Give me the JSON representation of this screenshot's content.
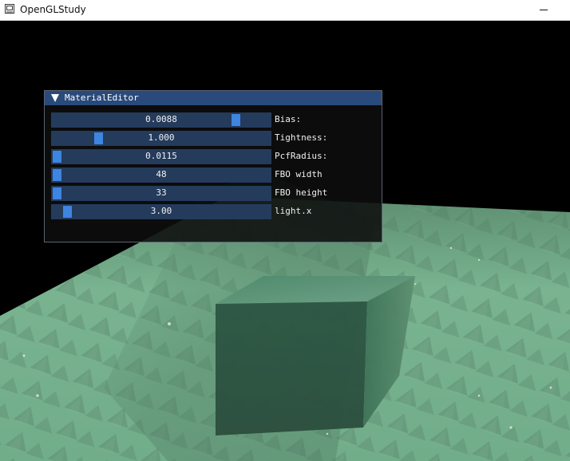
{
  "app": {
    "title": "OpenGLStudy",
    "icon": "app-window-icon",
    "controls": {
      "minimize_icon": "minimize-icon"
    }
  },
  "scene": {
    "background": "#000000",
    "terrain_color": "#79b38f",
    "cube_color": "#2f5a47"
  },
  "imgui": {
    "window_title": "MaterialEditor",
    "collapse_icon": "collapse-triangle-icon",
    "colors": {
      "title_bg": "#294a7a",
      "frame_bg": "#243b5c",
      "grab": "#3d85e0",
      "text": "#f0f0f0"
    },
    "sliders": [
      {
        "label": "Bias:",
        "value": "0.0088",
        "fraction": 0.86
      },
      {
        "label": "Tightness:",
        "value": "1.000",
        "fraction": 0.2
      },
      {
        "label": "PcfRadius:",
        "value": "0.0115",
        "fraction": 0.0
      },
      {
        "label": "FBO width",
        "value": "48",
        "fraction": 0.0
      },
      {
        "label": "FBO height",
        "value": "33",
        "fraction": 0.0
      },
      {
        "label": "light.x",
        "value": "3.00",
        "fraction": 0.05
      }
    ]
  }
}
